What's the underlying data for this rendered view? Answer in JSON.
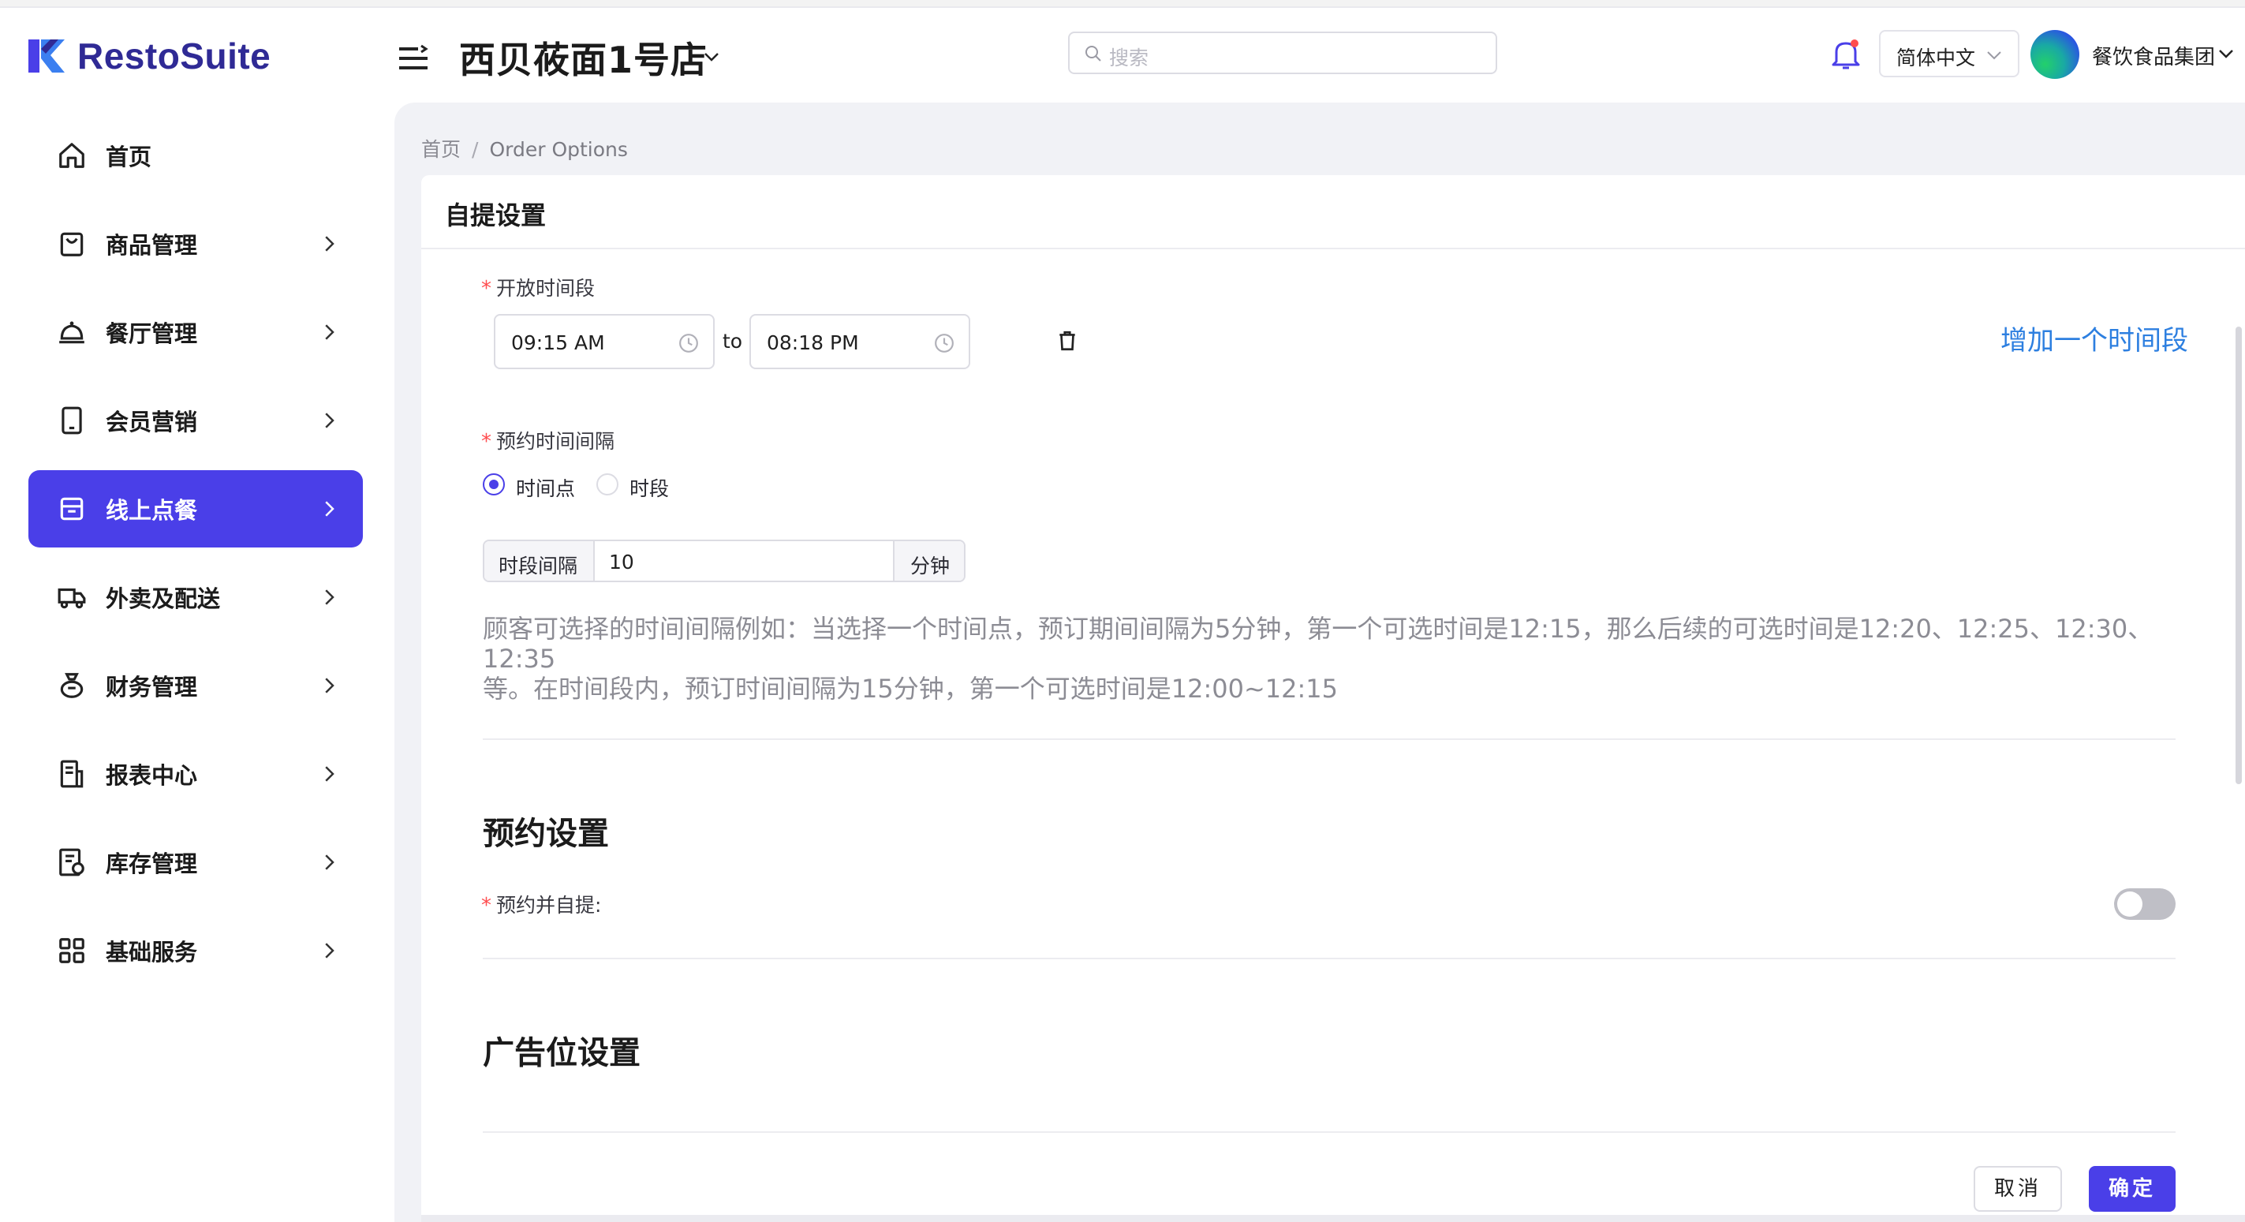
{
  "brand": {
    "name": "RestoSuite"
  },
  "sidebar": {
    "items": [
      {
        "label": "首页",
        "icon": "home-icon",
        "has_arrow": false,
        "active": false
      },
      {
        "label": "商品管理",
        "icon": "bag-icon",
        "has_arrow": true,
        "active": false
      },
      {
        "label": "餐厅管理",
        "icon": "cloche-icon",
        "has_arrow": true,
        "active": false
      },
      {
        "label": "会员营销",
        "icon": "phone-icon",
        "has_arrow": true,
        "active": false
      },
      {
        "label": "线上点餐",
        "icon": "box-icon",
        "has_arrow": true,
        "active": true
      },
      {
        "label": "外卖及配送",
        "icon": "truck-icon",
        "has_arrow": true,
        "active": false
      },
      {
        "label": "财务管理",
        "icon": "moneybag-icon",
        "has_arrow": true,
        "active": false
      },
      {
        "label": "报表中心",
        "icon": "report-icon",
        "has_arrow": true,
        "active": false
      },
      {
        "label": "库存管理",
        "icon": "inventory-icon",
        "has_arrow": true,
        "active": false
      },
      {
        "label": "基础服务",
        "icon": "grid-icon",
        "has_arrow": true,
        "active": false
      }
    ]
  },
  "header": {
    "store_name": "西贝莜面1号店",
    "search_placeholder": "搜索",
    "language": "简体中文",
    "organization": "餐饮食品集团"
  },
  "breadcrumb": {
    "home": "首页",
    "separator": "/",
    "current": "Order Options"
  },
  "pickup": {
    "title": "自提设置",
    "open_hours_label": "开放时间段",
    "start_time": "09:15 AM",
    "to_label": "to",
    "end_time": "08:18 PM",
    "add_period_link": "增加一个时间段",
    "interval_label": "预约时间间隔",
    "radio_point": "时间点",
    "radio_period": "时段",
    "selected_mode": "时间点",
    "interval_prefix": "时段间隔",
    "interval_value": "10",
    "interval_unit": "分钟",
    "hint_line1": "顾客可选择的时间间隔例如：当选择一个时间点，预订期间间隔为5分钟，第一个可选时间是12:15，那么后续的可选时间是12:20、12:25、12:30、12:35",
    "hint_line2": "等。在时间段内，预订时间间隔为15分钟，第一个可选时间是12:00~12:15"
  },
  "reservation": {
    "title": "预约设置",
    "pickup_label": "预约并自提:",
    "pickup_enabled": false
  },
  "ads": {
    "title": "广告位设置"
  },
  "actions": {
    "cancel": "取消",
    "confirm": "确定"
  },
  "colors": {
    "primary": "#4a3fe8",
    "brand": "#2f2a95",
    "link": "#2d7fe0",
    "required": "#ff4d4f"
  }
}
